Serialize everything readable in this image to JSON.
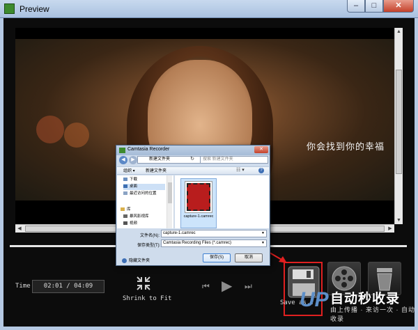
{
  "window": {
    "title": "Preview",
    "min": "–",
    "max": "□",
    "close": "✕"
  },
  "video": {
    "subtitle": "你会找到你的幸福"
  },
  "time": {
    "label": "Time",
    "value": "02:01 / 04:09"
  },
  "controls": {
    "shrink_label": "Shrink to Fit",
    "prev_icon": "⏮",
    "play_icon": "▶",
    "next_icon": "⏭",
    "save_label": "Save as..."
  },
  "dialog": {
    "title": "Camtasia Recorder",
    "back_icon": "◀",
    "forward_icon": "▶",
    "path": "新建文件夹",
    "refresh_icon": "↻",
    "search_placeholder": "搜索 新建文件夹",
    "toolbar_organize": "组织 ▾",
    "toolbar_newfolder": "新建文件夹",
    "view_icon": "☷ ▾",
    "help_icon": "?",
    "nav_items": [
      {
        "label": "下载",
        "selected": false
      },
      {
        "label": "桌面",
        "selected": true
      },
      {
        "label": "最近访问的位置",
        "selected": false
      },
      {
        "label": "",
        "selected": false
      },
      {
        "label": "库",
        "selected": false
      },
      {
        "label": "暴风影视库",
        "selected": false
      },
      {
        "label": "视频",
        "selected": false
      }
    ],
    "file_name": "capture-1.camrec",
    "filename_label": "文件名(N):",
    "filename_value": "capture-1.camrec",
    "filetype_label": "保存类型(T):",
    "filetype_value": "Camtasia Recording Files (*.camrec)",
    "hide_folders": "隐藏文件夹",
    "save_button": "保存(S)",
    "cancel_button": "取消"
  },
  "watermark": {
    "logo": "UP",
    "line1": "自动秒收录",
    "line2": "由上传播 · 来访一次 · 自动收录"
  }
}
